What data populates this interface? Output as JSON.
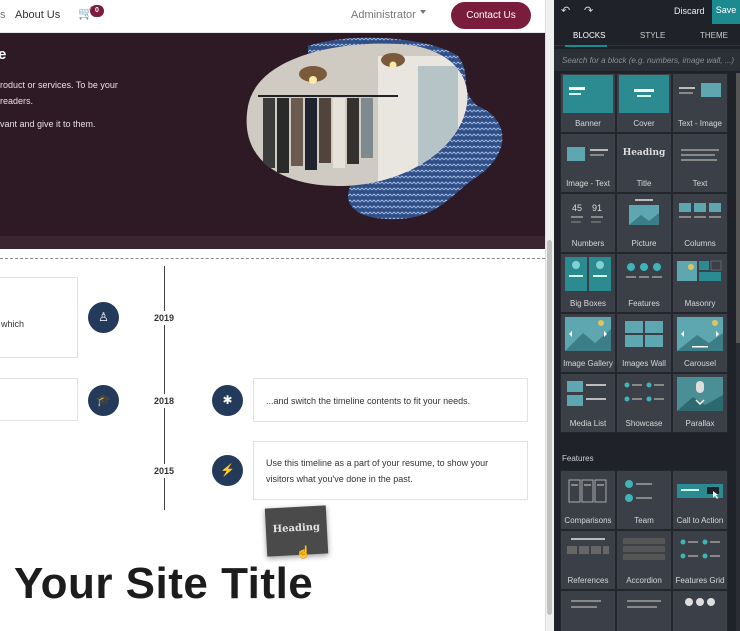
{
  "site": {
    "nav": {
      "cut_item": "s",
      "about": "About Us",
      "cart_icon": "cart-icon",
      "cart_count": "0",
      "admin": "Administrator",
      "contact": "Contact Us"
    },
    "hero": {
      "title": "e",
      "text1": "roduct or services. To be your readers.",
      "text2": "vant and give it to them."
    },
    "timeline": {
      "left_card_1": "which",
      "left_card_2": "",
      "years": [
        "2019",
        "2018",
        "2015"
      ],
      "right_card_1": "...and switch the timeline contents to fit your needs.",
      "right_card_2": "Use this timeline as a part of your resume, to show your visitors what you've done in the past."
    },
    "drag_tile": "Heading",
    "site_title": "Your Site Title",
    "colors": {
      "brand": "#7a1d3c",
      "hero_bg": "#2e1a24",
      "timeline_icon": "#243a5a"
    }
  },
  "editor": {
    "undo_icon": "undo-icon",
    "redo_icon": "redo-icon",
    "discard": "Discard",
    "save": "Save",
    "tabs": [
      "BLOCKS",
      "STYLE",
      "THEME"
    ],
    "search_placeholder": "Search for a block (e.g. numbers, image wall, ...)",
    "blocks": [
      {
        "label": "Banner"
      },
      {
        "label": "Cover"
      },
      {
        "label": "Text - Image"
      },
      {
        "label": "Image - Text"
      },
      {
        "label": "Title"
      },
      {
        "label": "Text"
      },
      {
        "label": "Numbers"
      },
      {
        "label": "Picture"
      },
      {
        "label": "Columns"
      },
      {
        "label": "Big Boxes"
      },
      {
        "label": "Features"
      },
      {
        "label": "Masonry"
      },
      {
        "label": "Image Gallery"
      },
      {
        "label": "Images Wall"
      },
      {
        "label": "Carousel"
      },
      {
        "label": "Media List"
      },
      {
        "label": "Showcase"
      },
      {
        "label": "Parallax"
      }
    ],
    "features_title": "Features",
    "feature_blocks": [
      {
        "label": "Comparisons"
      },
      {
        "label": "Team"
      },
      {
        "label": "Call to Action"
      },
      {
        "label": "References"
      },
      {
        "label": "Accordion"
      },
      {
        "label": "Features Grid"
      },
      {
        "label": ""
      },
      {
        "label": ""
      },
      {
        "label": ""
      }
    ],
    "title_block_text": "Heading",
    "numbers_block_text": [
      "45",
      "91"
    ],
    "colors": {
      "panel_bg": "#1f2228",
      "accent": "#1c8b8f",
      "tile_bg": "#3a3f48"
    }
  }
}
